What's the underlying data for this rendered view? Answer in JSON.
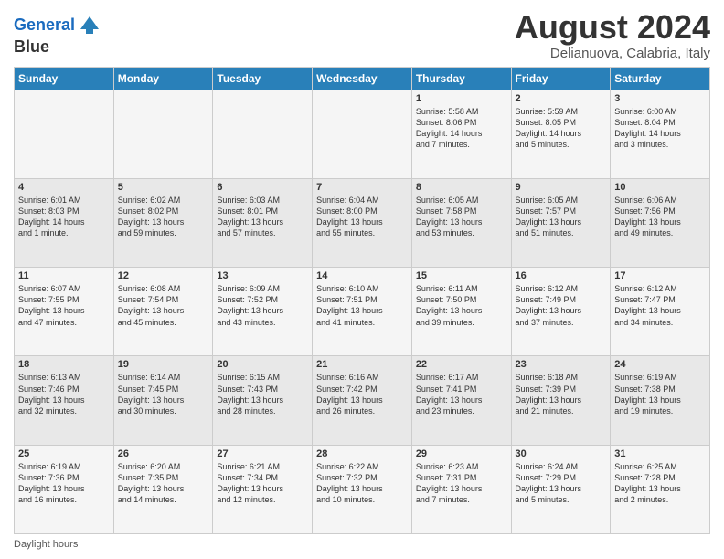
{
  "logo": {
    "line1": "General",
    "line2": "Blue"
  },
  "title": "August 2024",
  "subtitle": "Delianuova, Calabria, Italy",
  "days_header": [
    "Sunday",
    "Monday",
    "Tuesday",
    "Wednesday",
    "Thursday",
    "Friday",
    "Saturday"
  ],
  "footer": "Daylight hours",
  "weeks": [
    [
      {
        "day": "",
        "info": ""
      },
      {
        "day": "",
        "info": ""
      },
      {
        "day": "",
        "info": ""
      },
      {
        "day": "",
        "info": ""
      },
      {
        "day": "1",
        "info": "Sunrise: 5:58 AM\nSunset: 8:06 PM\nDaylight: 14 hours\nand 7 minutes."
      },
      {
        "day": "2",
        "info": "Sunrise: 5:59 AM\nSunset: 8:05 PM\nDaylight: 14 hours\nand 5 minutes."
      },
      {
        "day": "3",
        "info": "Sunrise: 6:00 AM\nSunset: 8:04 PM\nDaylight: 14 hours\nand 3 minutes."
      }
    ],
    [
      {
        "day": "4",
        "info": "Sunrise: 6:01 AM\nSunset: 8:03 PM\nDaylight: 14 hours\nand 1 minute."
      },
      {
        "day": "5",
        "info": "Sunrise: 6:02 AM\nSunset: 8:02 PM\nDaylight: 13 hours\nand 59 minutes."
      },
      {
        "day": "6",
        "info": "Sunrise: 6:03 AM\nSunset: 8:01 PM\nDaylight: 13 hours\nand 57 minutes."
      },
      {
        "day": "7",
        "info": "Sunrise: 6:04 AM\nSunset: 8:00 PM\nDaylight: 13 hours\nand 55 minutes."
      },
      {
        "day": "8",
        "info": "Sunrise: 6:05 AM\nSunset: 7:58 PM\nDaylight: 13 hours\nand 53 minutes."
      },
      {
        "day": "9",
        "info": "Sunrise: 6:05 AM\nSunset: 7:57 PM\nDaylight: 13 hours\nand 51 minutes."
      },
      {
        "day": "10",
        "info": "Sunrise: 6:06 AM\nSunset: 7:56 PM\nDaylight: 13 hours\nand 49 minutes."
      }
    ],
    [
      {
        "day": "11",
        "info": "Sunrise: 6:07 AM\nSunset: 7:55 PM\nDaylight: 13 hours\nand 47 minutes."
      },
      {
        "day": "12",
        "info": "Sunrise: 6:08 AM\nSunset: 7:54 PM\nDaylight: 13 hours\nand 45 minutes."
      },
      {
        "day": "13",
        "info": "Sunrise: 6:09 AM\nSunset: 7:52 PM\nDaylight: 13 hours\nand 43 minutes."
      },
      {
        "day": "14",
        "info": "Sunrise: 6:10 AM\nSunset: 7:51 PM\nDaylight: 13 hours\nand 41 minutes."
      },
      {
        "day": "15",
        "info": "Sunrise: 6:11 AM\nSunset: 7:50 PM\nDaylight: 13 hours\nand 39 minutes."
      },
      {
        "day": "16",
        "info": "Sunrise: 6:12 AM\nSunset: 7:49 PM\nDaylight: 13 hours\nand 37 minutes."
      },
      {
        "day": "17",
        "info": "Sunrise: 6:12 AM\nSunset: 7:47 PM\nDaylight: 13 hours\nand 34 minutes."
      }
    ],
    [
      {
        "day": "18",
        "info": "Sunrise: 6:13 AM\nSunset: 7:46 PM\nDaylight: 13 hours\nand 32 minutes."
      },
      {
        "day": "19",
        "info": "Sunrise: 6:14 AM\nSunset: 7:45 PM\nDaylight: 13 hours\nand 30 minutes."
      },
      {
        "day": "20",
        "info": "Sunrise: 6:15 AM\nSunset: 7:43 PM\nDaylight: 13 hours\nand 28 minutes."
      },
      {
        "day": "21",
        "info": "Sunrise: 6:16 AM\nSunset: 7:42 PM\nDaylight: 13 hours\nand 26 minutes."
      },
      {
        "day": "22",
        "info": "Sunrise: 6:17 AM\nSunset: 7:41 PM\nDaylight: 13 hours\nand 23 minutes."
      },
      {
        "day": "23",
        "info": "Sunrise: 6:18 AM\nSunset: 7:39 PM\nDaylight: 13 hours\nand 21 minutes."
      },
      {
        "day": "24",
        "info": "Sunrise: 6:19 AM\nSunset: 7:38 PM\nDaylight: 13 hours\nand 19 minutes."
      }
    ],
    [
      {
        "day": "25",
        "info": "Sunrise: 6:19 AM\nSunset: 7:36 PM\nDaylight: 13 hours\nand 16 minutes."
      },
      {
        "day": "26",
        "info": "Sunrise: 6:20 AM\nSunset: 7:35 PM\nDaylight: 13 hours\nand 14 minutes."
      },
      {
        "day": "27",
        "info": "Sunrise: 6:21 AM\nSunset: 7:34 PM\nDaylight: 13 hours\nand 12 minutes."
      },
      {
        "day": "28",
        "info": "Sunrise: 6:22 AM\nSunset: 7:32 PM\nDaylight: 13 hours\nand 10 minutes."
      },
      {
        "day": "29",
        "info": "Sunrise: 6:23 AM\nSunset: 7:31 PM\nDaylight: 13 hours\nand 7 minutes."
      },
      {
        "day": "30",
        "info": "Sunrise: 6:24 AM\nSunset: 7:29 PM\nDaylight: 13 hours\nand 5 minutes."
      },
      {
        "day": "31",
        "info": "Sunrise: 6:25 AM\nSunset: 7:28 PM\nDaylight: 13 hours\nand 2 minutes."
      }
    ]
  ]
}
